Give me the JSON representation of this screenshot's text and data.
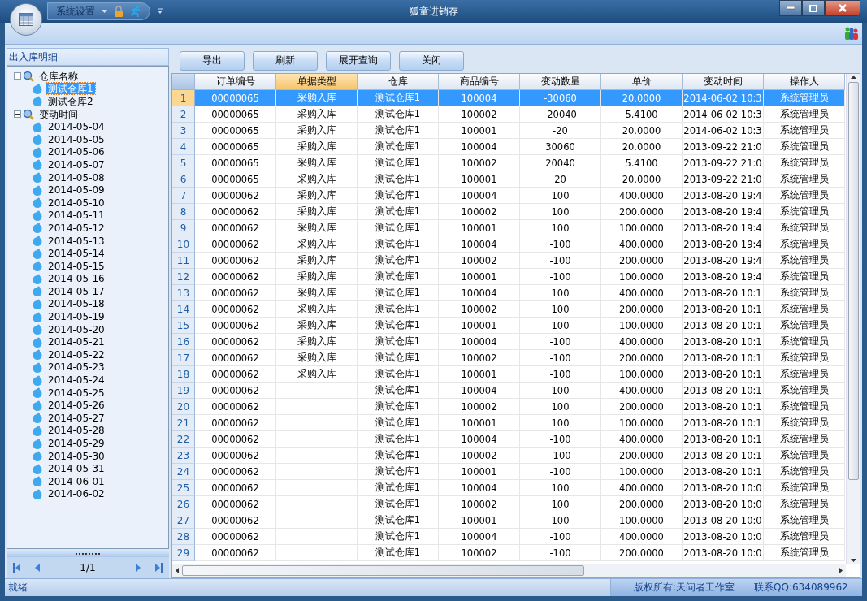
{
  "window": {
    "title": "狐童进销存",
    "quick_access": "系统设置"
  },
  "left_panel": {
    "title": "出入库明细",
    "tree": [
      {
        "label": "仓库名称",
        "expanded": true,
        "children": [
          {
            "label": "测试仓库1",
            "selected": true
          },
          {
            "label": "测试仓库2",
            "selected": false
          }
        ]
      },
      {
        "label": "变动时间",
        "expanded": true,
        "children": [
          {
            "label": "2014-05-04",
            "selected": false
          },
          {
            "label": "2014-05-05",
            "selected": false
          },
          {
            "label": "2014-05-06",
            "selected": false
          },
          {
            "label": "2014-05-07",
            "selected": false
          },
          {
            "label": "2014-05-08",
            "selected": false
          },
          {
            "label": "2014-05-09",
            "selected": false
          },
          {
            "label": "2014-05-10",
            "selected": false
          },
          {
            "label": "2014-05-11",
            "selected": false
          },
          {
            "label": "2014-05-12",
            "selected": false
          },
          {
            "label": "2014-05-13",
            "selected": false
          },
          {
            "label": "2014-05-14",
            "selected": false
          },
          {
            "label": "2014-05-15",
            "selected": false
          },
          {
            "label": "2014-05-16",
            "selected": false
          },
          {
            "label": "2014-05-17",
            "selected": false
          },
          {
            "label": "2014-05-18",
            "selected": false
          },
          {
            "label": "2014-05-19",
            "selected": false
          },
          {
            "label": "2014-05-20",
            "selected": false
          },
          {
            "label": "2014-05-21",
            "selected": false
          },
          {
            "label": "2014-05-22",
            "selected": false
          },
          {
            "label": "2014-05-23",
            "selected": false
          },
          {
            "label": "2014-05-24",
            "selected": false
          },
          {
            "label": "2014-05-25",
            "selected": false
          },
          {
            "label": "2014-05-26",
            "selected": false
          },
          {
            "label": "2014-05-27",
            "selected": false
          },
          {
            "label": "2014-05-28",
            "selected": false
          },
          {
            "label": "2014-05-29",
            "selected": false
          },
          {
            "label": "2014-05-30",
            "selected": false
          },
          {
            "label": "2014-05-31",
            "selected": false
          },
          {
            "label": "2014-06-01",
            "selected": false
          },
          {
            "label": "2014-06-02",
            "selected": false
          }
        ]
      }
    ],
    "pager": "1/1"
  },
  "toolbar": [
    "导出",
    "刷新",
    "展开查询",
    "关闭"
  ],
  "table": {
    "columns": [
      {
        "label": "订单编号",
        "selected": false
      },
      {
        "label": "单据类型",
        "selected": true
      },
      {
        "label": "仓库",
        "selected": false
      },
      {
        "label": "商品编号",
        "selected": false
      },
      {
        "label": "变动数量",
        "selected": false
      },
      {
        "label": "单价",
        "selected": false
      },
      {
        "label": "变动时间",
        "selected": false
      },
      {
        "label": "操作人",
        "selected": false
      }
    ],
    "rows": [
      {
        "n": "1",
        "selected": true,
        "cells": [
          "00000065",
          "采购入库",
          "测试仓库1",
          "100004",
          "-30060",
          "20.0000",
          "2014-06-02 10:3",
          "系统管理员"
        ]
      },
      {
        "n": "2",
        "selected": false,
        "cells": [
          "00000065",
          "采购入库",
          "测试仓库1",
          "100002",
          "-20040",
          "5.4100",
          "2014-06-02 10:3",
          "系统管理员"
        ]
      },
      {
        "n": "3",
        "selected": false,
        "cells": [
          "00000065",
          "采购入库",
          "测试仓库1",
          "100001",
          "-20",
          "20.0000",
          "2014-06-02 10:3",
          "系统管理员"
        ]
      },
      {
        "n": "4",
        "selected": false,
        "cells": [
          "00000065",
          "采购入库",
          "测试仓库1",
          "100004",
          "30060",
          "20.0000",
          "2013-09-22 21:0",
          "系统管理员"
        ]
      },
      {
        "n": "5",
        "selected": false,
        "cells": [
          "00000065",
          "采购入库",
          "测试仓库1",
          "100002",
          "20040",
          "5.4100",
          "2013-09-22 21:0",
          "系统管理员"
        ]
      },
      {
        "n": "6",
        "selected": false,
        "cells": [
          "00000065",
          "采购入库",
          "测试仓库1",
          "100001",
          "20",
          "20.0000",
          "2013-09-22 21:0",
          "系统管理员"
        ]
      },
      {
        "n": "7",
        "selected": false,
        "cells": [
          "00000062",
          "采购入库",
          "测试仓库1",
          "100004",
          "100",
          "400.0000",
          "2013-08-20 19:4",
          "系统管理员"
        ]
      },
      {
        "n": "8",
        "selected": false,
        "cells": [
          "00000062",
          "采购入库",
          "测试仓库1",
          "100002",
          "100",
          "200.0000",
          "2013-08-20 19:4",
          "系统管理员"
        ]
      },
      {
        "n": "9",
        "selected": false,
        "cells": [
          "00000062",
          "采购入库",
          "测试仓库1",
          "100001",
          "100",
          "100.0000",
          "2013-08-20 19:4",
          "系统管理员"
        ]
      },
      {
        "n": "10",
        "selected": false,
        "cells": [
          "00000062",
          "采购入库",
          "测试仓库1",
          "100004",
          "-100",
          "400.0000",
          "2013-08-20 19:4",
          "系统管理员"
        ]
      },
      {
        "n": "11",
        "selected": false,
        "cells": [
          "00000062",
          "采购入库",
          "测试仓库1",
          "100002",
          "-100",
          "200.0000",
          "2013-08-20 19:4",
          "系统管理员"
        ]
      },
      {
        "n": "12",
        "selected": false,
        "cells": [
          "00000062",
          "采购入库",
          "测试仓库1",
          "100001",
          "-100",
          "100.0000",
          "2013-08-20 19:4",
          "系统管理员"
        ]
      },
      {
        "n": "13",
        "selected": false,
        "cells": [
          "00000062",
          "采购入库",
          "测试仓库1",
          "100004",
          "100",
          "400.0000",
          "2013-08-20 10:1",
          "系统管理员"
        ]
      },
      {
        "n": "14",
        "selected": false,
        "cells": [
          "00000062",
          "采购入库",
          "测试仓库1",
          "100002",
          "100",
          "200.0000",
          "2013-08-20 10:1",
          "系统管理员"
        ]
      },
      {
        "n": "15",
        "selected": false,
        "cells": [
          "00000062",
          "采购入库",
          "测试仓库1",
          "100001",
          "100",
          "100.0000",
          "2013-08-20 10:1",
          "系统管理员"
        ]
      },
      {
        "n": "16",
        "selected": false,
        "cells": [
          "00000062",
          "采购入库",
          "测试仓库1",
          "100004",
          "-100",
          "400.0000",
          "2013-08-20 10:1",
          "系统管理员"
        ]
      },
      {
        "n": "17",
        "selected": false,
        "cells": [
          "00000062",
          "采购入库",
          "测试仓库1",
          "100002",
          "-100",
          "200.0000",
          "2013-08-20 10:1",
          "系统管理员"
        ]
      },
      {
        "n": "18",
        "selected": false,
        "cells": [
          "00000062",
          "采购入库",
          "测试仓库1",
          "100001",
          "-100",
          "100.0000",
          "2013-08-20 10:1",
          "系统管理员"
        ]
      },
      {
        "n": "19",
        "selected": false,
        "cells": [
          "00000062",
          null,
          "测试仓库1",
          "100004",
          "100",
          "400.0000",
          "2013-08-20 10:1",
          "系统管理员"
        ]
      },
      {
        "n": "20",
        "selected": false,
        "cells": [
          "00000062",
          null,
          "测试仓库1",
          "100002",
          "100",
          "200.0000",
          "2013-08-20 10:1",
          "系统管理员"
        ]
      },
      {
        "n": "21",
        "selected": false,
        "cells": [
          "00000062",
          null,
          "测试仓库1",
          "100001",
          "100",
          "100.0000",
          "2013-08-20 10:1",
          "系统管理员"
        ]
      },
      {
        "n": "22",
        "selected": false,
        "cells": [
          "00000062",
          null,
          "测试仓库1",
          "100004",
          "-100",
          "400.0000",
          "2013-08-20 10:1",
          "系统管理员"
        ]
      },
      {
        "n": "23",
        "selected": false,
        "cells": [
          "00000062",
          null,
          "测试仓库1",
          "100002",
          "-100",
          "200.0000",
          "2013-08-20 10:1",
          "系统管理员"
        ]
      },
      {
        "n": "24",
        "selected": false,
        "cells": [
          "00000062",
          null,
          "测试仓库1",
          "100001",
          "-100",
          "100.0000",
          "2013-08-20 10:1",
          "系统管理员"
        ]
      },
      {
        "n": "25",
        "selected": false,
        "cells": [
          "00000062",
          null,
          "测试仓库1",
          "100004",
          "100",
          "400.0000",
          "2013-08-20 10:0",
          "系统管理员"
        ]
      },
      {
        "n": "26",
        "selected": false,
        "cells": [
          "00000062",
          null,
          "测试仓库1",
          "100002",
          "100",
          "200.0000",
          "2013-08-20 10:0",
          "系统管理员"
        ]
      },
      {
        "n": "27",
        "selected": false,
        "cells": [
          "00000062",
          null,
          "测试仓库1",
          "100001",
          "100",
          "100.0000",
          "2013-08-20 10:0",
          "系统管理员"
        ]
      },
      {
        "n": "28",
        "selected": false,
        "cells": [
          "00000062",
          null,
          "测试仓库1",
          "100004",
          "-100",
          "400.0000",
          "2013-08-20 10:0",
          "系统管理员"
        ]
      },
      {
        "n": "29",
        "selected": false,
        "cells": [
          "00000062",
          null,
          "测试仓库1",
          "100002",
          "-100",
          "200.0000",
          "2013-08-20 10:0",
          "系统管理员"
        ]
      }
    ]
  },
  "status_bar": {
    "state": "就绪",
    "copyright": "版权所有:天问者工作室",
    "contact": "联系QQ:634089962"
  }
}
